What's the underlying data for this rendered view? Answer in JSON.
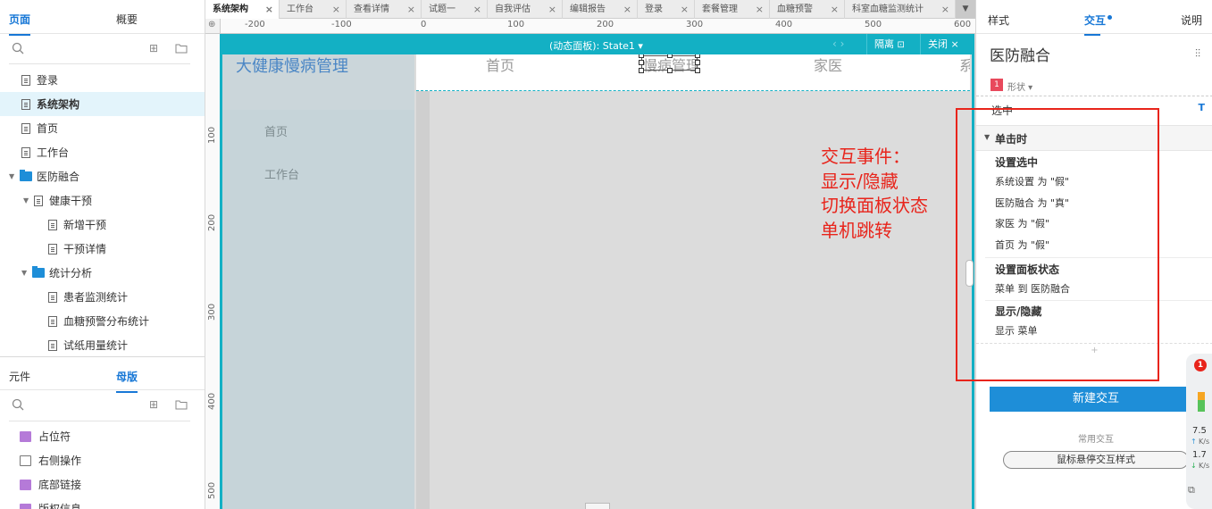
{
  "left": {
    "tabs": [
      "页面",
      "概要"
    ],
    "pages": [
      {
        "label": "登录",
        "type": "page"
      },
      {
        "label": "系统架构",
        "type": "page",
        "selected": true
      },
      {
        "label": "首页",
        "type": "page"
      },
      {
        "label": "工作台",
        "type": "page"
      },
      {
        "label": "医防融合",
        "type": "folder"
      },
      {
        "label": "健康干预",
        "type": "page"
      },
      {
        "label": "新增干预",
        "type": "page"
      },
      {
        "label": "干预详情",
        "type": "page"
      },
      {
        "label": "统计分析",
        "type": "folder"
      },
      {
        "label": "患者监测统计",
        "type": "page"
      },
      {
        "label": "血糖预警分布统计",
        "type": "page"
      },
      {
        "label": "试纸用量统计",
        "type": "page"
      }
    ],
    "bottom_tabs": [
      "元件",
      "母版"
    ],
    "masters": [
      "占位符",
      "右侧操作",
      "底部链接",
      "版权信息"
    ]
  },
  "center": {
    "doc_tabs": [
      "系统架构",
      "工作台",
      "查看详情",
      "试题一",
      "自我评估",
      "编辑报告",
      "登录",
      "套餐管理",
      "血糖预警",
      "科室血糖监测统计"
    ],
    "ruler_h": [
      "-200",
      "-100",
      "0",
      "100",
      "200",
      "300",
      "400",
      "500",
      "600"
    ],
    "ruler_v": [
      "100",
      "200",
      "300",
      "400",
      "500"
    ],
    "panel": {
      "state_label": "(动态面板): State1 ▾",
      "nav": "‹ ›",
      "isolate": "隔离",
      "close": "关闭"
    },
    "canvas": {
      "logo": "大健康慢病管理",
      "side_items": [
        "首页",
        "工作台"
      ],
      "nav_items": [
        "首页",
        "慢病管理",
        "家医",
        "系"
      ]
    },
    "annotation": [
      "交互事件：",
      "显示/隐藏",
      "切换面板状态",
      "单机跳转"
    ]
  },
  "right": {
    "tabs": [
      "样式",
      "交互",
      "说明"
    ],
    "widget_name": "医防融合",
    "shape_badge": "1",
    "shape_label": "形状 ▾",
    "selected_label": "选中",
    "selected_icon": "T",
    "event": "单击时",
    "actions": [
      {
        "title": "设置选中",
        "lines": [
          "系统设置 为 \"假\"",
          "医防融合 为 \"真\"",
          "家医 为 \"假\"",
          "首页 为 \"假\""
        ]
      },
      {
        "title": "设置面板状态",
        "lines": [
          "菜单 到 医防融合"
        ]
      },
      {
        "title": "显示/隐藏",
        "lines": [
          "显示 菜单"
        ]
      }
    ],
    "add": "+",
    "new_interaction": "新建交互",
    "common_label": "常用交互",
    "hover_button": "鼠标悬停交互样式"
  },
  "float_widget": {
    "badge": "1",
    "up_value": "7.5",
    "up_unit": "K/s",
    "down_value": "1.7",
    "down_unit": "K/s"
  },
  "colors": {
    "accent": "#1777d6",
    "panel_teal": "#13b0c4",
    "annotation_red": "#e8241b",
    "primary_button": "#1e8ed8"
  }
}
